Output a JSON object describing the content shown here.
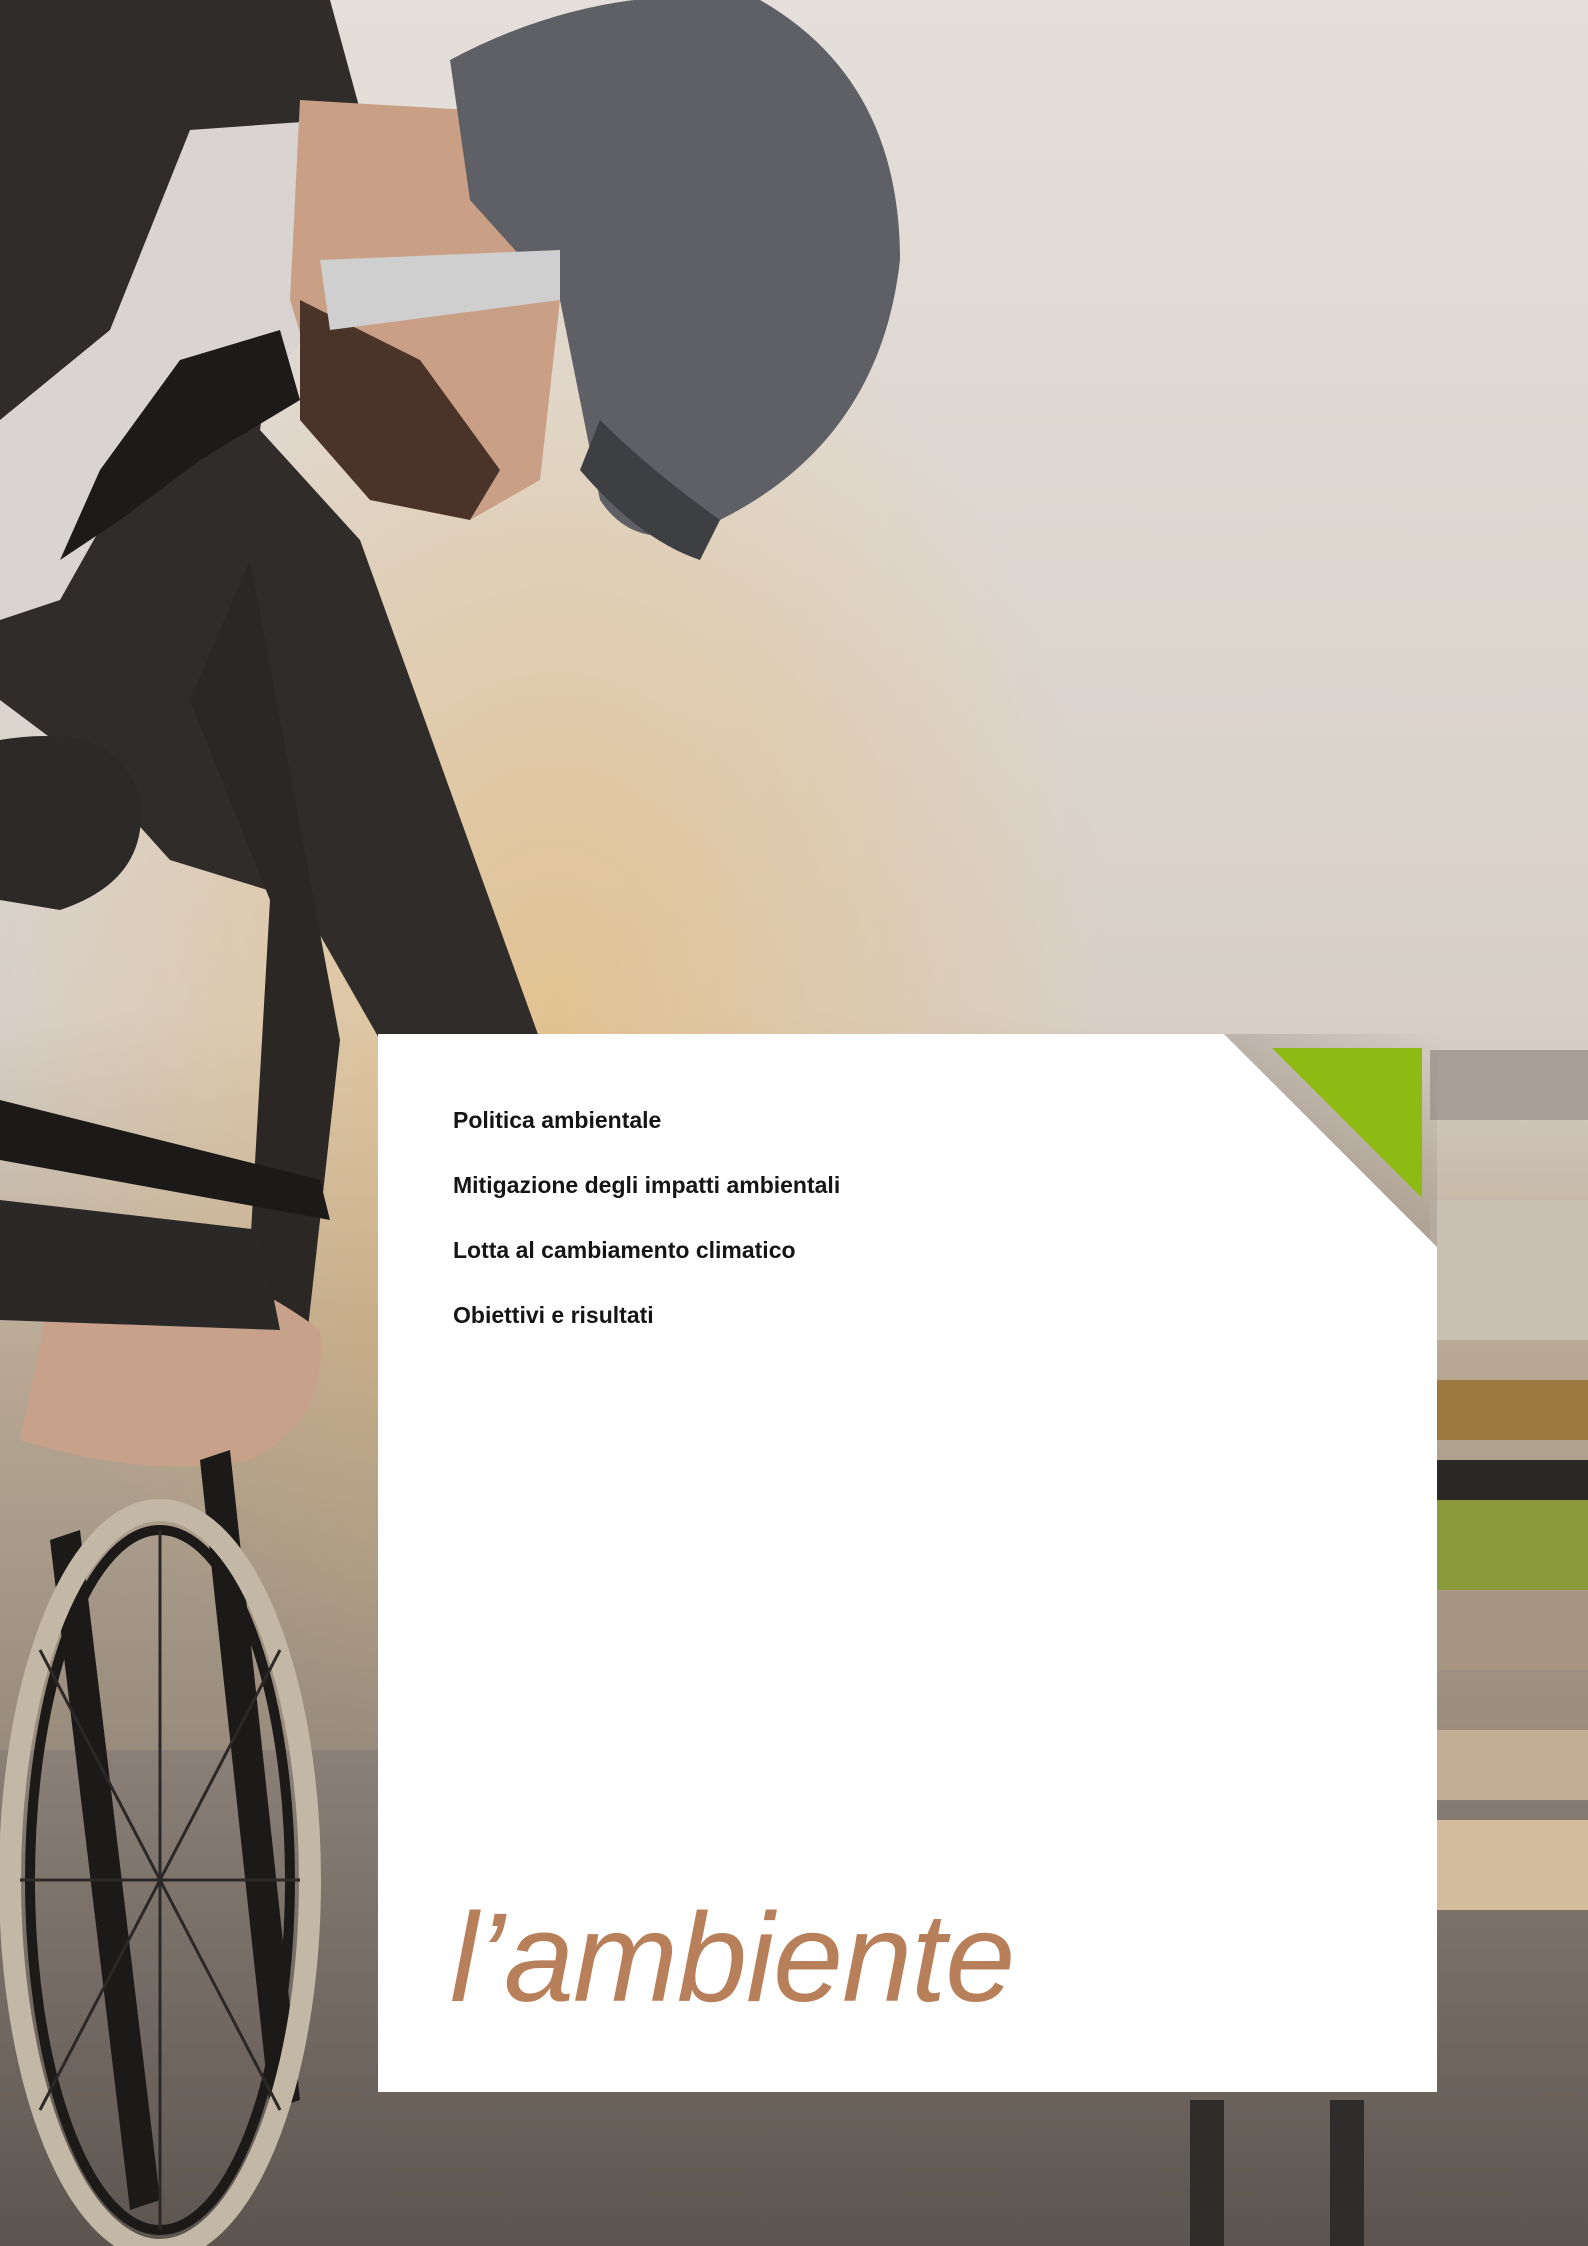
{
  "toc": {
    "items": [
      "Politica ambientale",
      "Mitigazione degli impatti ambientali",
      "Lotta al cambiamento climatico",
      "Obiettivi e risultati"
    ]
  },
  "title": "l’ambiente",
  "colors": {
    "accent_green": "#8dba13",
    "title_brown": "#b8805a",
    "text_dark": "#151515",
    "card_white": "#ffffff"
  },
  "image": {
    "scene": "man-in-helmet-adjusting-e-bike-battery-photo"
  }
}
